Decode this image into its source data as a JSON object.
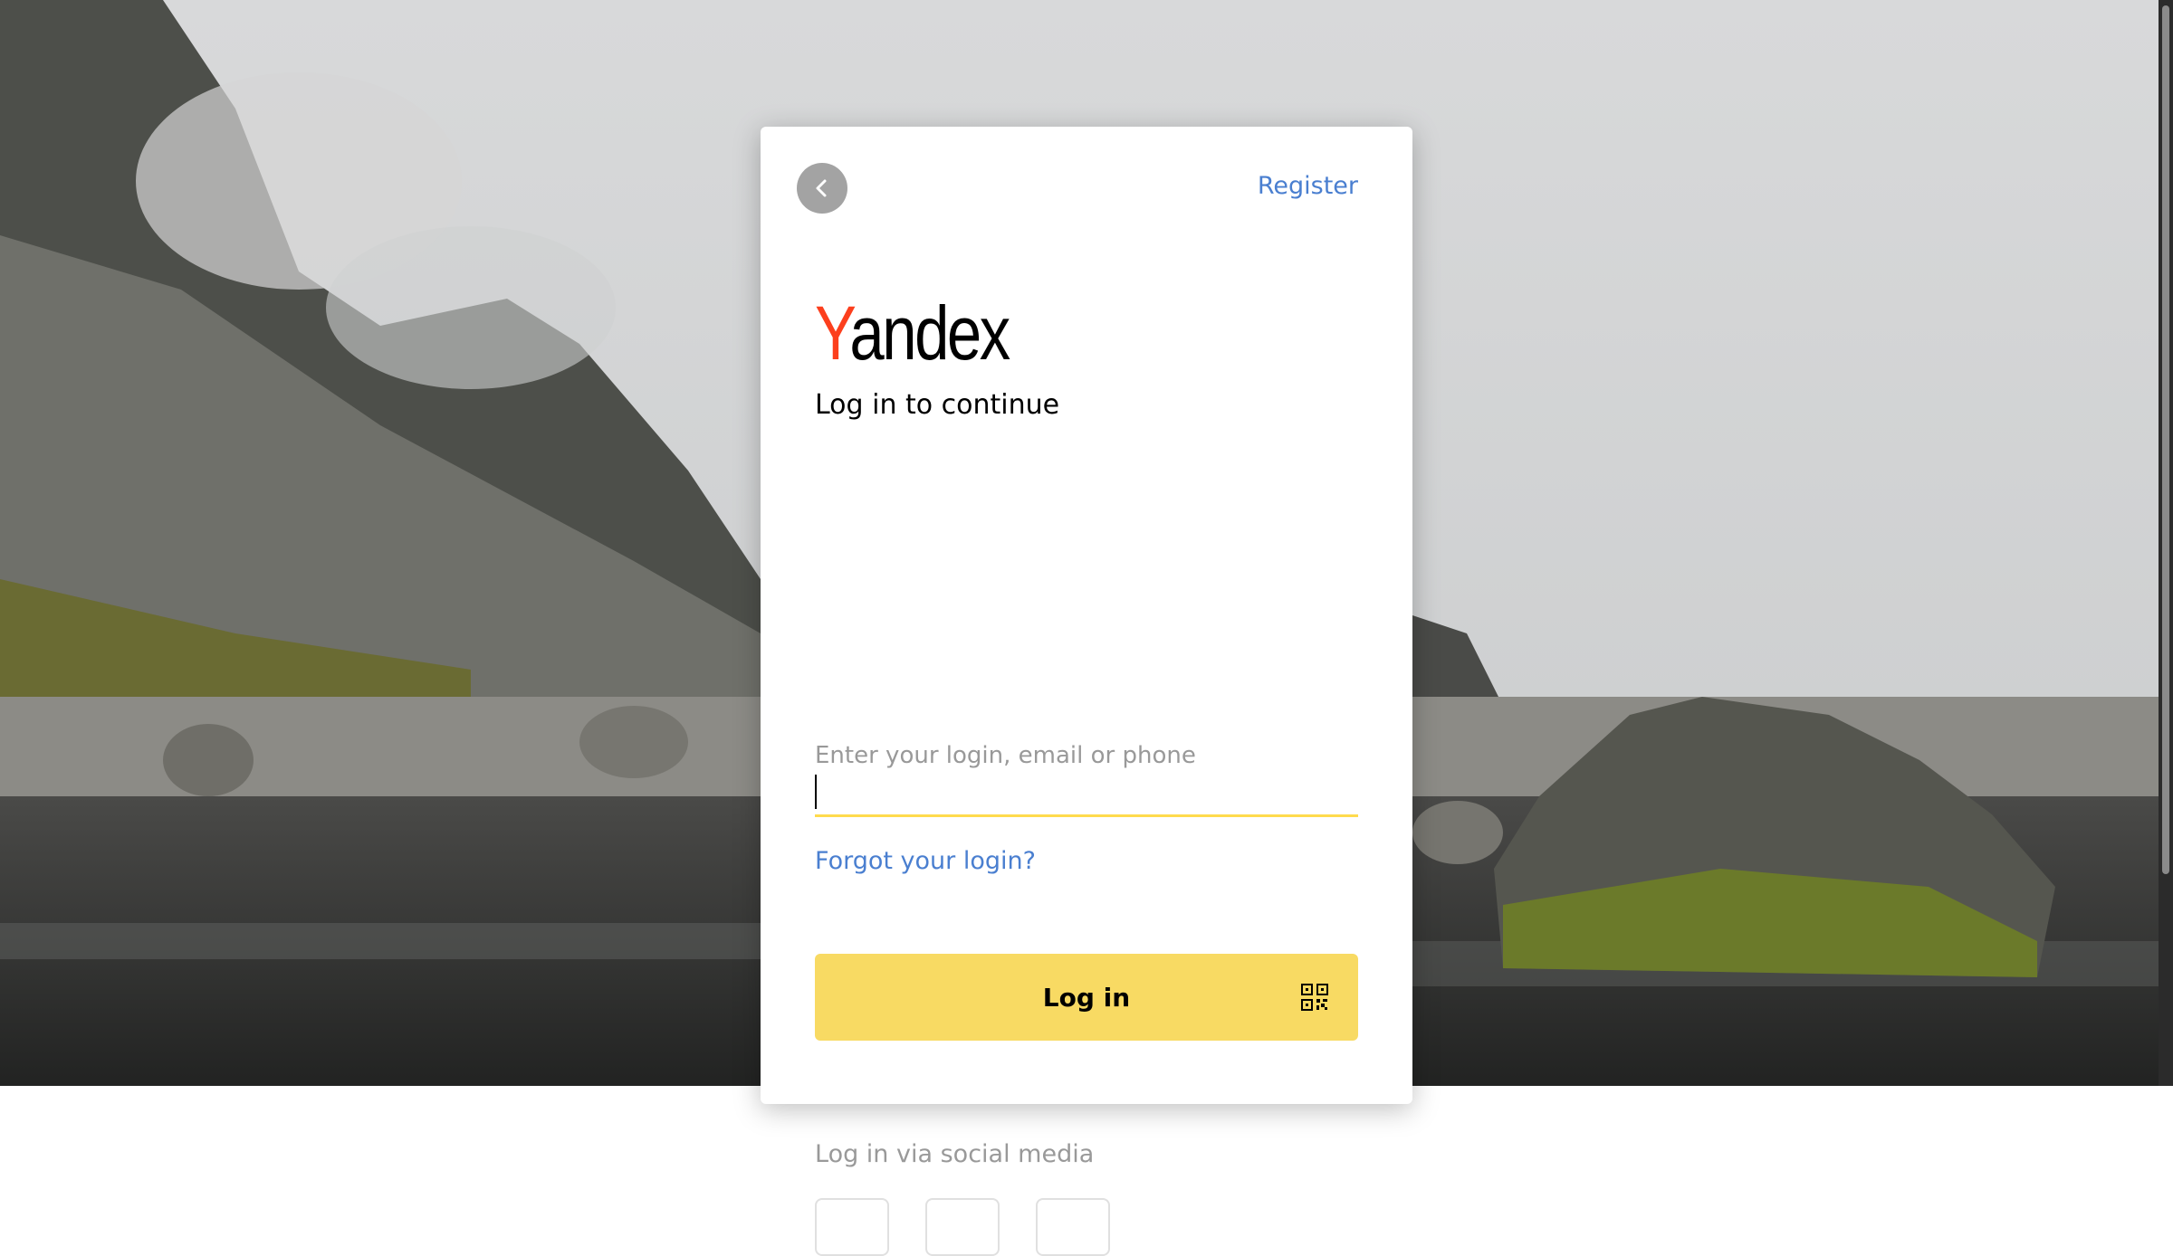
{
  "header": {
    "back_button_label": "Back",
    "register_label": "Register"
  },
  "logo": {
    "first_letter": "Y",
    "rest": "andex"
  },
  "subtitle": "Log in to continue",
  "login_field": {
    "label": "Enter your login, email or phone",
    "value": ""
  },
  "forgot_label": "Forgot your login?",
  "login_button": {
    "label": "Log in",
    "icon": "qr-code-icon"
  },
  "social": {
    "label": "Log in via social media"
  },
  "colors": {
    "accent_yellow": "#f8da63",
    "link_blue": "#4a7fd0",
    "logo_red": "#fc3f1d"
  }
}
